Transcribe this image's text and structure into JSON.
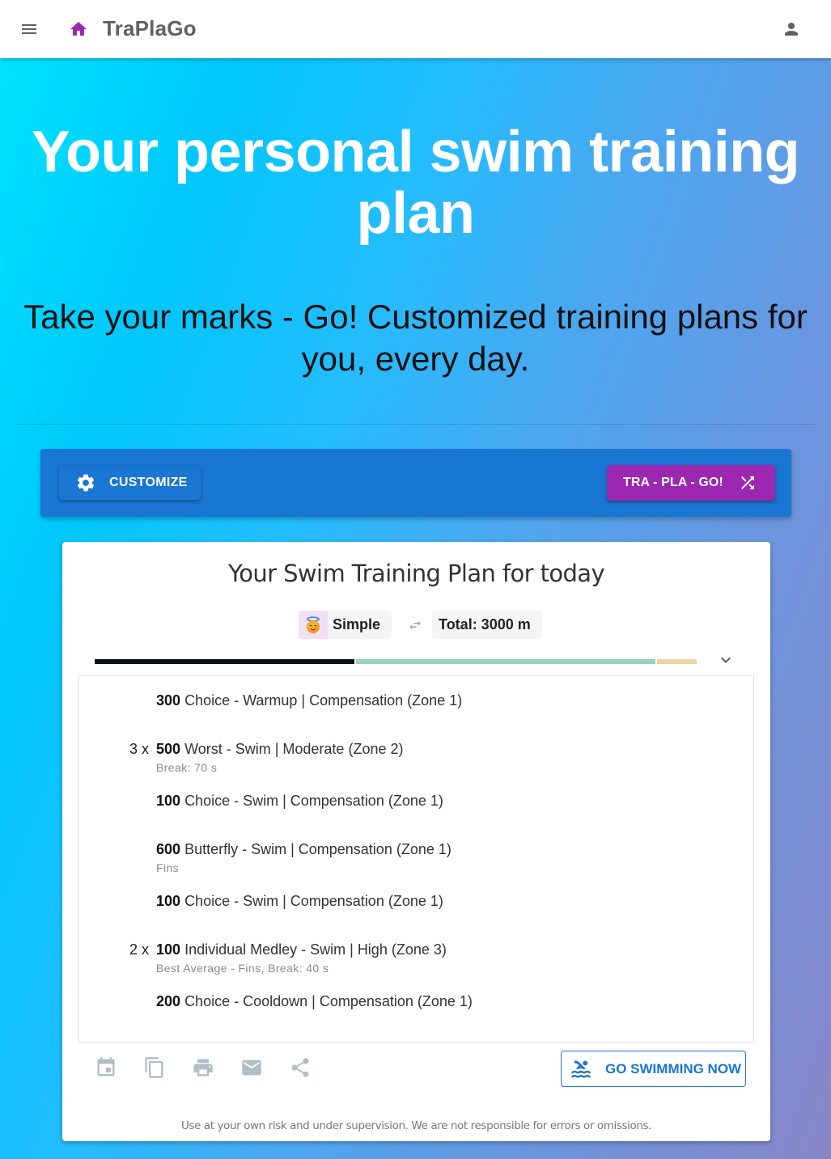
{
  "appbar": {
    "brand": "TraPlaGo",
    "icons": {
      "menu": "menu-icon",
      "home": "home-icon",
      "account": "account-icon"
    },
    "home_color": "#9c27b0"
  },
  "hero": {
    "title": "Your personal swim training plan",
    "subtitle": "Take your marks - Go! Customized training plans for you, every day."
  },
  "toolbar": {
    "customize_label": "CUSTOMIZE",
    "customize_icon": "gear-icon",
    "go_label": "TRA - PLA - GO!",
    "go_icon": "shuffle-icon",
    "bg_color": "#1976d2",
    "go_color": "#9c27b0"
  },
  "plan": {
    "title": "Your Swim Training Plan for today",
    "level": {
      "emoji": "smiling-face-with-halo",
      "label": "Simple"
    },
    "total_label": "Total: 3000 m",
    "zone_distribution": [
      {
        "zone": "Zone 1",
        "meters": 1300,
        "color": "#04111b"
      },
      {
        "zone": "Zone 2",
        "meters": 1500,
        "color": "#97d3bc"
      },
      {
        "zone": "Zone 3",
        "meters": 200,
        "color": "#e9d5a3"
      }
    ],
    "items": [
      {
        "reps": "",
        "distance": "300",
        "text": "Choice - Warmup | Compensation (Zone 1)",
        "note": ""
      },
      {
        "reps": "3 x",
        "distance": "500",
        "text": "Worst - Swim | Moderate (Zone 2)",
        "note": "Break: 70 s"
      },
      {
        "reps": "",
        "distance": "100",
        "text": "Choice - Swim | Compensation (Zone 1)",
        "note": ""
      },
      {
        "reps": "",
        "distance": "600",
        "text": "Butterfly - Swim | Compensation (Zone 1)",
        "note": "Fins"
      },
      {
        "reps": "",
        "distance": "100",
        "text": "Choice - Swim | Compensation (Zone 1)",
        "note": ""
      },
      {
        "reps": "2 x",
        "distance": "100",
        "text": "Individual Medley - Swim | High (Zone 3)",
        "note": "Best Average - Fins, Break: 40 s"
      },
      {
        "reps": "",
        "distance": "200",
        "text": "Choice - Cooldown | Compensation (Zone 1)",
        "note": ""
      }
    ],
    "actions": [
      "calendar-icon",
      "copy-icon",
      "print-icon",
      "email-icon",
      "share-icon"
    ],
    "swim_button_label": "GO SWIMMING NOW",
    "disclaimer": "Use at your own risk and under supervision. We are not responsible for errors or omissions."
  }
}
